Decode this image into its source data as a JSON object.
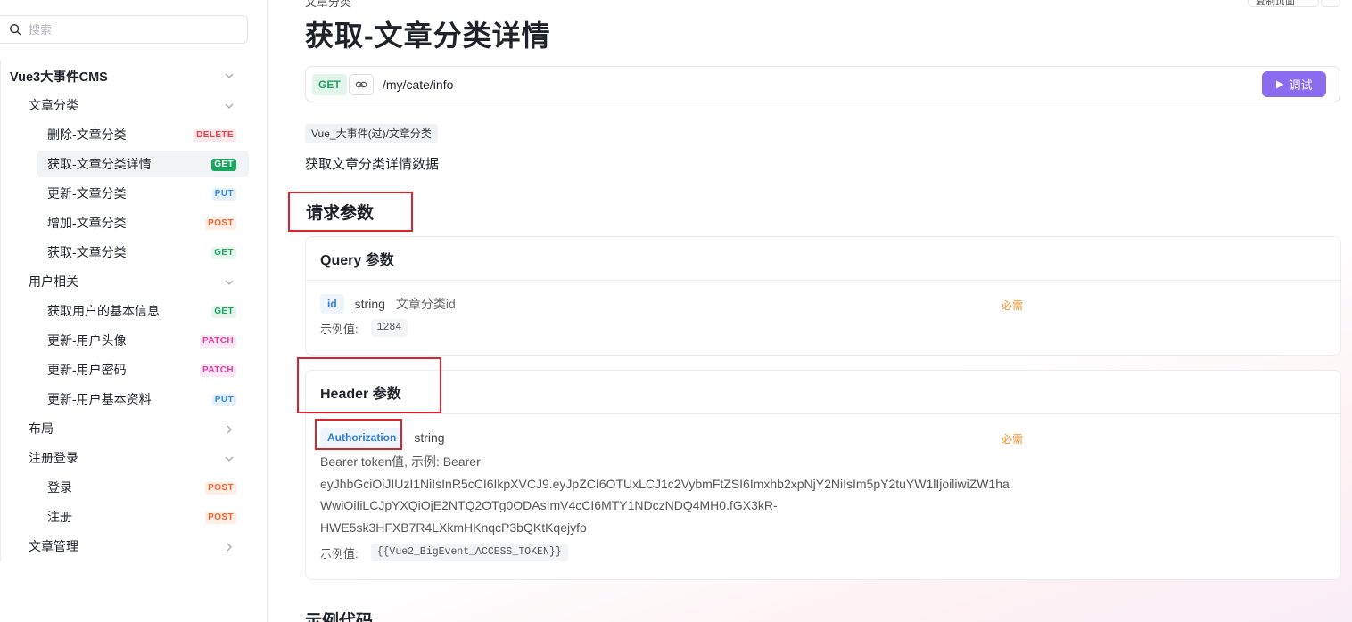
{
  "search": {
    "placeholder": "搜索"
  },
  "sidebar": {
    "root": {
      "label": "Vue3大事件CMS"
    },
    "groups": [
      {
        "label": "文章分类",
        "items": [
          {
            "label": "删除-文章分类",
            "method": "DELETE"
          },
          {
            "label": "获取-文章分类详情",
            "method": "GET",
            "active": true
          },
          {
            "label": "更新-文章分类",
            "method": "PUT"
          },
          {
            "label": "增加-文章分类",
            "method": "POST"
          },
          {
            "label": "获取-文章分类",
            "method": "GET"
          }
        ]
      },
      {
        "label": "用户相关",
        "items": [
          {
            "label": "获取用户的基本信息",
            "method": "GET"
          },
          {
            "label": "更新-用户头像",
            "method": "PATCH"
          },
          {
            "label": "更新-用户密码",
            "method": "PATCH"
          },
          {
            "label": "更新-用户基本资料",
            "method": "PUT"
          }
        ]
      },
      {
        "label": "布局",
        "items": []
      },
      {
        "label": "注册登录",
        "items": [
          {
            "label": "登录",
            "method": "POST"
          },
          {
            "label": "注册",
            "method": "POST"
          }
        ]
      },
      {
        "label": "文章管理",
        "items": []
      }
    ]
  },
  "header": {
    "breadcrumb": "文章分类",
    "copy_page_label": "复制页面",
    "title": "获取-文章分类详情"
  },
  "endpoint": {
    "method": "GET",
    "path": "/my/cate/info",
    "debug_label": "调试"
  },
  "folder_tag": "Vue_大事件(过)/文章分类",
  "description": "获取文章分类详情数据",
  "request_params": {
    "title": "请求参数",
    "query": {
      "title": "Query 参数",
      "params": [
        {
          "name": "id",
          "type": "string",
          "description": "文章分类id",
          "required_label": "必需",
          "example_label": "示例值:",
          "example": "1284"
        }
      ]
    },
    "header": {
      "title": "Header 参数",
      "params": [
        {
          "name": "Authorization",
          "type": "string",
          "required_label": "必需",
          "description_lines": [
            "Bearer token值, 示例: Bearer",
            "eyJhbGciOiJIUzI1NiIsInR5cCI6IkpXVCJ9.eyJpZCI6OTUxLCJ1c2VybmFtZSI6Imxhb2xpNjY2NiIsIm5pY2tuYW1lIjoiliwiZW1ha",
            "WwiOiIiLCJpYXQiOjE2NTQ2OTg0ODAsImV4cCI6MTY1NDczNDQ4MH0.fGX3kR-",
            "HWE5sk3HFXB7R4LXkmHKnqcP3bQKtKqejyfo"
          ],
          "example_label": "示例值:",
          "example": "{{Vue2_BigEvent_ACCESS_TOKEN}}"
        }
      ]
    }
  },
  "next_section": {
    "title": "示例代码"
  },
  "colors": {
    "accent": "#8a6cf0",
    "get": "#1aa760",
    "post": "#f0642d",
    "put": "#2f88e8",
    "patch": "#e13ea0",
    "delete": "#e8404b",
    "required": "#f0932b",
    "highlight_box": "#d9232e"
  }
}
